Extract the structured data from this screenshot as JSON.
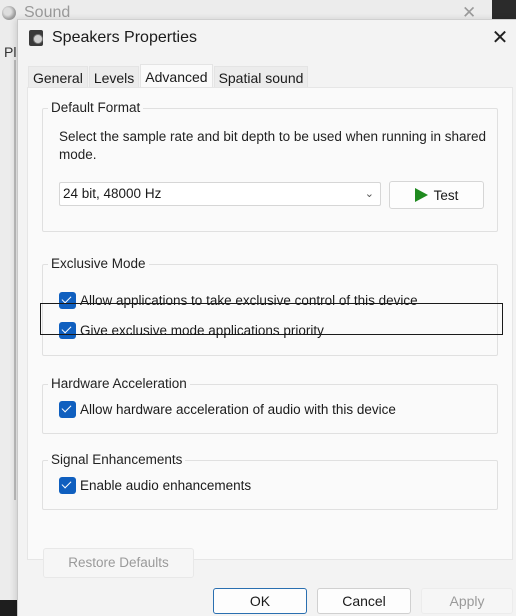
{
  "background_window": {
    "title": "Sound",
    "partial_tab": "Pl"
  },
  "dialog": {
    "title": "Speakers Properties",
    "close_label": "✕",
    "tabs": [
      {
        "label": "General",
        "active": false
      },
      {
        "label": "Levels",
        "active": false
      },
      {
        "label": "Advanced",
        "active": true
      },
      {
        "label": "Spatial sound",
        "active": false
      }
    ],
    "default_format": {
      "group_label": "Default Format",
      "description": "Select the sample rate and bit depth to be used when running in shared mode.",
      "selected_format": "24 bit, 48000 Hz",
      "test_label": "Test"
    },
    "exclusive_mode": {
      "group_label": "Exclusive Mode",
      "options": [
        {
          "label": "Allow applications to take exclusive control of this device",
          "checked": true
        },
        {
          "label": "Give exclusive mode applications priority",
          "checked": true
        }
      ]
    },
    "hardware_acceleration": {
      "group_label": "Hardware Acceleration",
      "options": [
        {
          "label": "Allow hardware acceleration of audio with this device",
          "checked": true
        }
      ]
    },
    "signal_enhancements": {
      "group_label": "Signal Enhancements",
      "options": [
        {
          "label": "Enable audio enhancements",
          "checked": true
        }
      ]
    },
    "restore_defaults_label": "Restore Defaults",
    "buttons": {
      "ok": "OK",
      "cancel": "Cancel",
      "apply": "Apply"
    }
  },
  "colors": {
    "checkbox": "#0f5fbf",
    "play_icon": "#1f8a1f",
    "ok_border": "#2a6fb0"
  }
}
